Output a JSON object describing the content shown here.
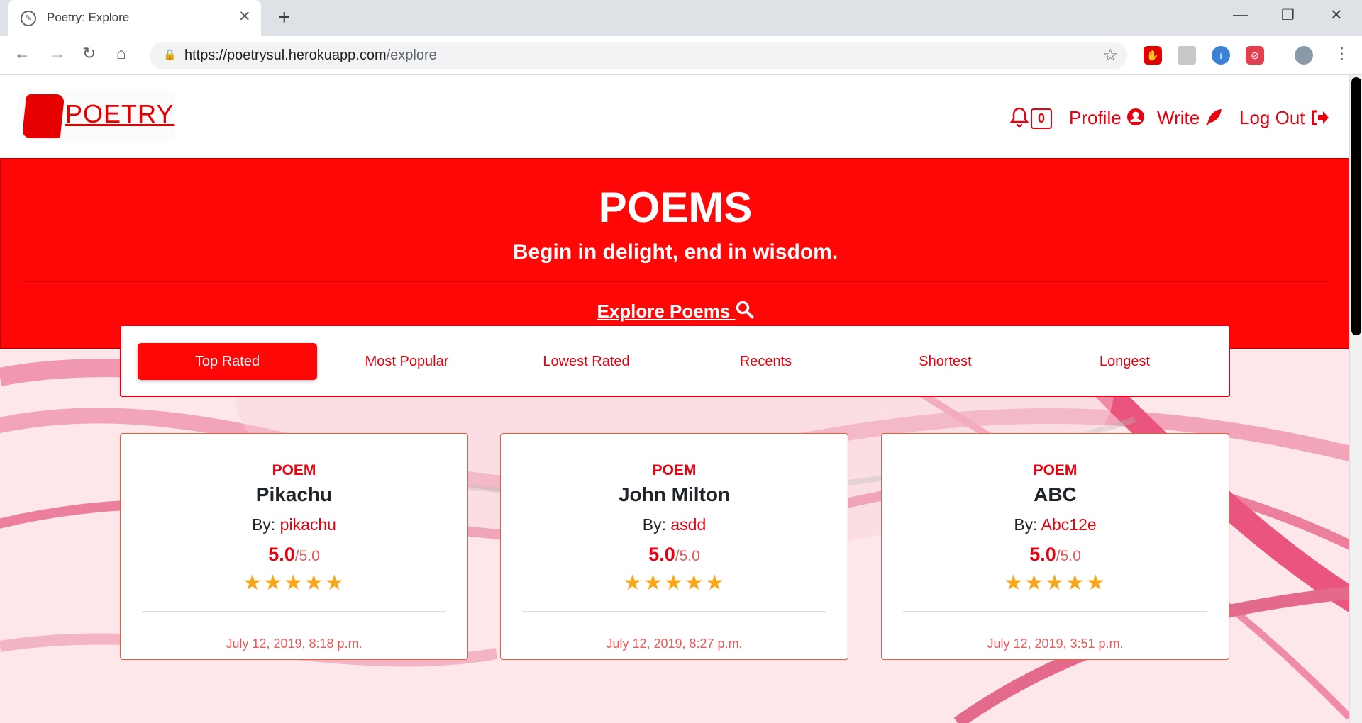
{
  "browser": {
    "tab_title": "Poetry: Explore",
    "tab_close": "✕",
    "new_tab": "+",
    "url_host": "https://poetrysul.herokuapp.com",
    "url_path": "/explore",
    "minimize": "—",
    "restore": "❐",
    "close": "✕",
    "back": "←",
    "forward": "→",
    "reload": "↻",
    "home": "⌂",
    "star": "☆",
    "menu": "⋮"
  },
  "site": {
    "logo_text": "POETRY",
    "nav": {
      "notification_count": "0",
      "profile": "Profile",
      "write": "Write",
      "logout": "Log Out"
    },
    "hero": {
      "title": "POEMS",
      "subtitle": "Begin in delight, end in wisdom.",
      "explore_link": "Explore Poems "
    },
    "filters": [
      "Top Rated",
      "Most Popular",
      "Lowest Rated",
      "Recents",
      "Shortest",
      "Longest"
    ],
    "active_filter": "Top Rated",
    "cards": [
      {
        "type": "POEM",
        "title": "Pikachu",
        "by_label": "By: ",
        "author": "pikachu",
        "rating": "5.0",
        "max": "/5.0",
        "stars": 5,
        "date": "July 12, 2019, 8:18 p.m."
      },
      {
        "type": "POEM",
        "title": "John Milton",
        "by_label": "By: ",
        "author": "asdd",
        "rating": "5.0",
        "max": "/5.0",
        "stars": 5,
        "date": "July 12, 2019, 8:27 p.m."
      },
      {
        "type": "POEM",
        "title": "ABC",
        "by_label": "By: ",
        "author": "Abc12e",
        "rating": "5.0",
        "max": "/5.0",
        "stars": 5,
        "date": "July 12, 2019, 3:51 p.m."
      }
    ],
    "star_glyphs": "★★★★★"
  },
  "colors": {
    "brand_red": "#ff0707",
    "link_red": "#e8000e",
    "star_gold": "#f8a61c",
    "page_bg_pink": "#fde7eb"
  }
}
